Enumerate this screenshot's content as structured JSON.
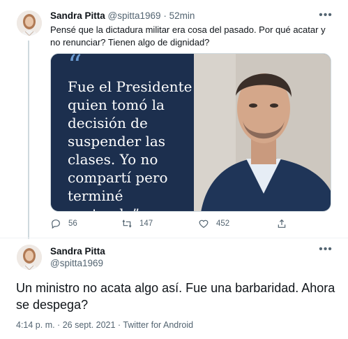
{
  "tweet1": {
    "author_name": "Sandra Pitta",
    "author_handle": "@spitta1969",
    "separator": "·",
    "time": "52min",
    "text": "Pensé que la dictadura militar era cosa del pasado. Por qué acatar y no renunciar? Tienen algo de dignidad?",
    "media": {
      "quote_marks": "“",
      "quote_text": "Fue el Presidente quien tomó la decisión de suspender las clases. Yo no compartí pero terminé acatando”",
      "quote_color": "#1c2f4e"
    },
    "actions": {
      "replies": "56",
      "retweets": "147",
      "likes": "452"
    }
  },
  "tweet2": {
    "author_name": "Sandra Pitta",
    "author_handle": "@spitta1969",
    "text": "Un ministro no acata algo así. Fue una barbaridad. Ahora se despega?",
    "meta": "4:14 p. m. · 26 sept. 2021 · Twitter for Android"
  },
  "icons": {
    "more": "more-horizontal-icon",
    "reply": "reply-icon",
    "retweet": "retweet-icon",
    "like": "heart-icon",
    "share": "share-icon"
  }
}
